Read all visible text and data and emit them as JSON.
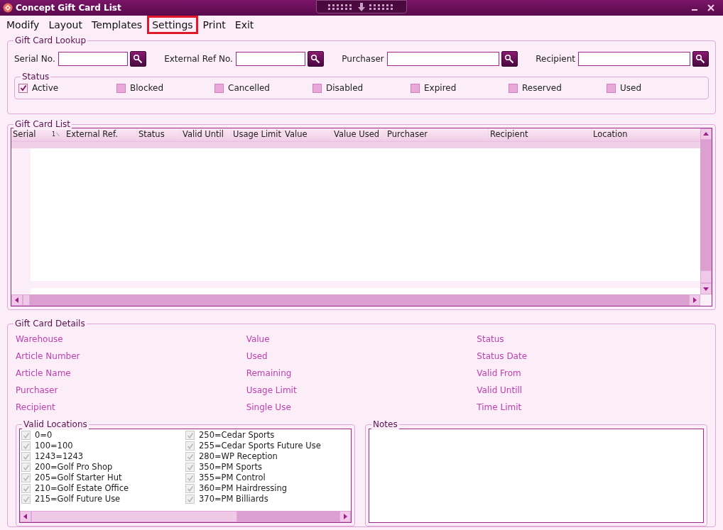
{
  "window": {
    "title": "Concept Gift Card List"
  },
  "menu": [
    {
      "label": "Modify",
      "highlighted": false
    },
    {
      "label": "Layout",
      "highlighted": false
    },
    {
      "label": "Templates",
      "highlighted": false
    },
    {
      "label": "Settings",
      "highlighted": true
    },
    {
      "label": "Print",
      "highlighted": false
    },
    {
      "label": "Exit",
      "highlighted": false
    }
  ],
  "lookup": {
    "title": "Gift Card Lookup",
    "fields": [
      {
        "label": "Serial No."
      },
      {
        "label": "External Ref No."
      },
      {
        "label": "Purchaser"
      },
      {
        "label": "Recipient"
      }
    ],
    "status_title": "Status",
    "statuses": [
      {
        "label": "Active",
        "checked": true
      },
      {
        "label": "Blocked",
        "checked": false
      },
      {
        "label": "Cancelled",
        "checked": false
      },
      {
        "label": "Disabled",
        "checked": false
      },
      {
        "label": "Expired",
        "checked": false
      },
      {
        "label": "Reserved",
        "checked": false
      },
      {
        "label": "Used",
        "checked": false
      }
    ]
  },
  "list": {
    "title": "Gift Card List",
    "sort_order": "1",
    "columns": [
      "Serial",
      "External Ref.",
      "Status",
      "Valid Until",
      "Usage Limit",
      "Value",
      "Value Used",
      "Purchaser",
      "Recipient",
      "Location"
    ]
  },
  "details": {
    "title": "Gift Card Details",
    "columns": [
      [
        "Warehouse",
        "Article Number",
        "Article Name",
        "Purchaser",
        "Recipient"
      ],
      [
        "Value",
        "Used",
        "Remaining",
        "Usage Limit",
        "Single Use"
      ],
      [
        "Status",
        "Status Date",
        "Valid From",
        "Valid Untill",
        "Time Limit"
      ]
    ],
    "locations_title": "Valid Locations",
    "locations": [
      {
        "label": "0=0",
        "checked": true
      },
      {
        "label": "100=100",
        "checked": true
      },
      {
        "label": "1243=1243",
        "checked": true
      },
      {
        "label": "200=Golf Pro Shop",
        "checked": true
      },
      {
        "label": "205=Golf Starter Hut",
        "checked": true
      },
      {
        "label": "210=Golf Estate Office",
        "checked": true
      },
      {
        "label": "215=Golf Future Use",
        "checked": true
      },
      {
        "label": "250=Cedar Sports",
        "checked": true
      },
      {
        "label": "255=Cedar Sports Future Use",
        "checked": true
      },
      {
        "label": "280=WP Reception",
        "checked": true
      },
      {
        "label": "350=PM Sports",
        "checked": true
      },
      {
        "label": "355=PM Control",
        "checked": true
      },
      {
        "label": "360=PM Hairdressing",
        "checked": true
      },
      {
        "label": "370=PM Billiards",
        "checked": true
      }
    ],
    "notes_title": "Notes"
  }
}
